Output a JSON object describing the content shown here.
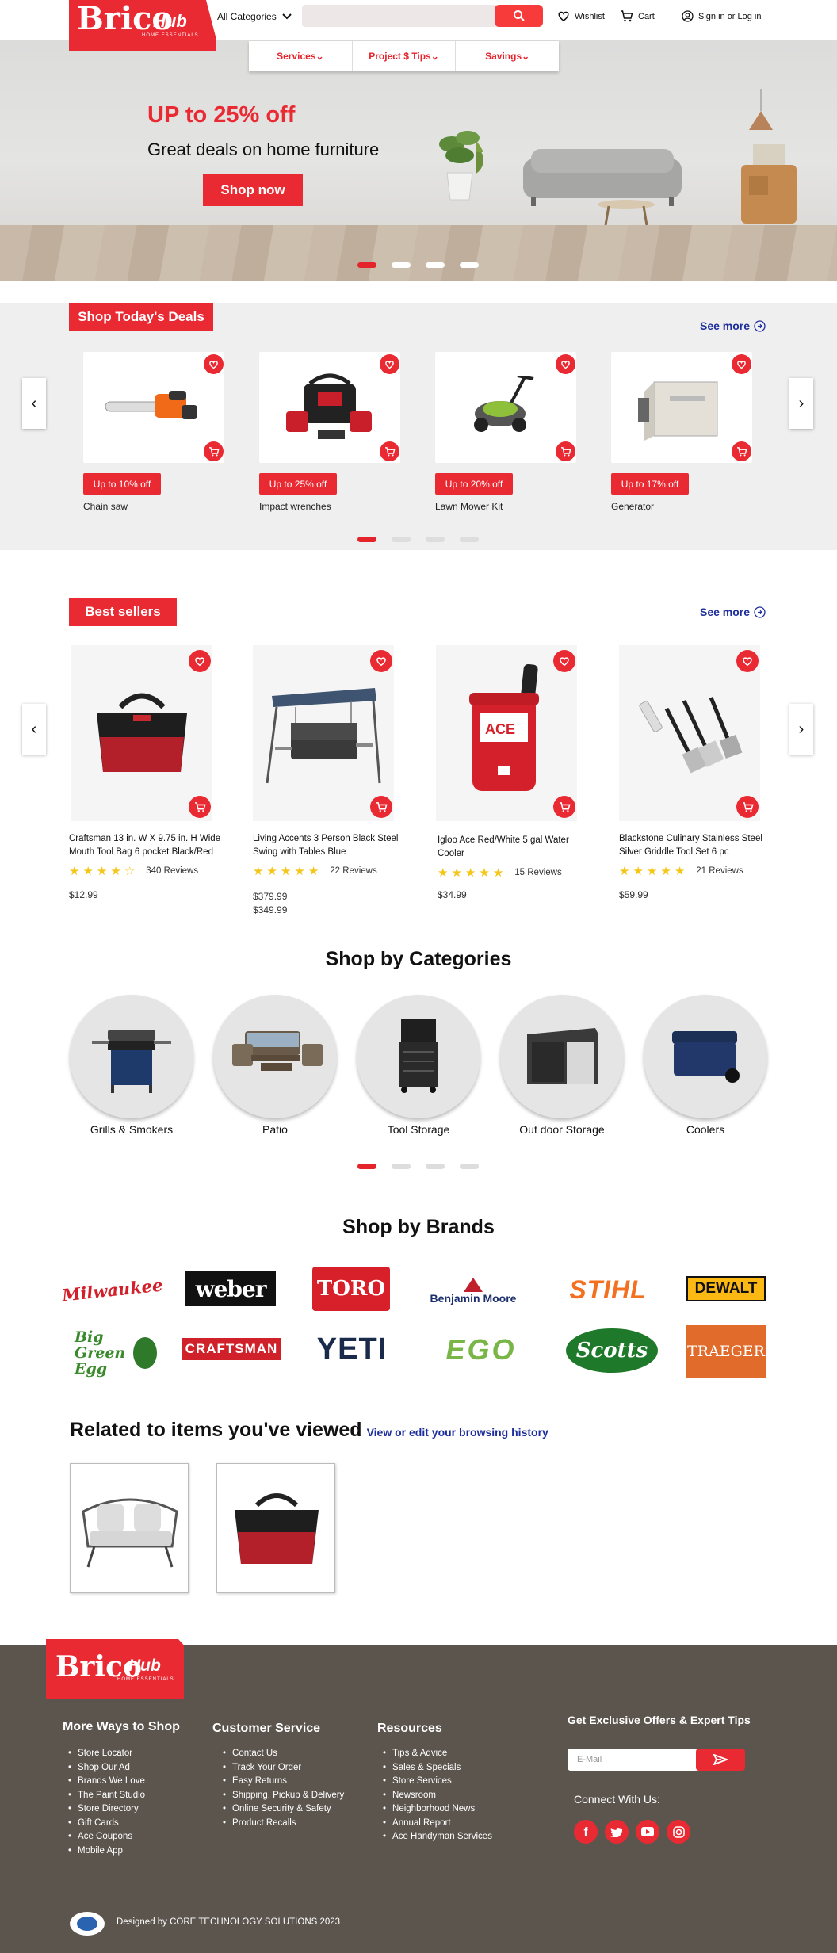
{
  "colors": {
    "brand_red": "#ea2a33",
    "link_blue": "#1d2e9c",
    "footer_bg": "#5c554e"
  },
  "header": {
    "logo_brico": "Brico",
    "logo_hub": "Hub",
    "logo_tagline": "HOME ESSENTIALS",
    "all_categories": "All Categories",
    "search_placeholder": "",
    "wishlist": "Wishlist",
    "cart": "Cart",
    "signin": "Sign in or Log in"
  },
  "nav": [
    {
      "label": "Services"
    },
    {
      "label": "Project $ Tips"
    },
    {
      "label": "Savings"
    }
  ],
  "hero": {
    "title": "UP to 25% off",
    "subtitle": "Great deals on home furniture",
    "button": "Shop now"
  },
  "deals": {
    "heading": "Shop Today's Deals",
    "see_more": "See more",
    "items": [
      {
        "badge": "Up to 10% off",
        "name": "Chain saw",
        "icon": "chainsaw-icon"
      },
      {
        "badge": "Up to 25% off",
        "name": "Impact wrenches",
        "icon": "drill-kit-icon"
      },
      {
        "badge": "Up to 20% off",
        "name": "Lawn Mower Kit",
        "icon": "lawn-mower-icon"
      },
      {
        "badge": "Up to 17% off",
        "name": "Generator",
        "icon": "generator-icon"
      }
    ]
  },
  "bestsellers": {
    "heading": "Best sellers",
    "see_more": "See more",
    "items": [
      {
        "name": "Craftsman 13 in. W X 9.75 in. H Wide Mouth Tool Bag 6 pocket Black/Red",
        "rating": 4,
        "reviews": "340 Reviews",
        "price": "$12.99",
        "price2": ""
      },
      {
        "name": "Living Accents 3 Person Black Steel Swing with Tables Blue",
        "rating": 5,
        "reviews": "22 Reviews",
        "price": "$379.99",
        "price2": "$349.99"
      },
      {
        "name": "Igloo Ace Red/White 5 gal Water Cooler",
        "rating": 5,
        "reviews": "15 Reviews",
        "price": "$34.99",
        "price2": ""
      },
      {
        "name": "Blackstone Culinary Stainless Steel Silver Griddle Tool Set 6 pc",
        "rating": 5,
        "reviews": "21 Reviews",
        "price": "$59.99",
        "price2": ""
      }
    ]
  },
  "categories": {
    "heading": "Shop by Categories",
    "items": [
      {
        "label": "Grills & Smokers"
      },
      {
        "label": "Patio"
      },
      {
        "label": "Tool Storage"
      },
      {
        "label": "Out door Storage"
      },
      {
        "label": "Coolers"
      }
    ]
  },
  "brands": {
    "heading": "Shop by Brands",
    "items": [
      "Milwaukee",
      "weber",
      "TORO",
      "Benjamin Moore",
      "STIHL",
      "DEWALT",
      "Big Green Egg",
      "CRAFTSMAN",
      "YETI",
      "EGO",
      "Scotts",
      "TRAEGER"
    ]
  },
  "related": {
    "heading": "Related to items you've viewed",
    "link": "View or edit your browsing history"
  },
  "footer": {
    "col1": {
      "heading": "More Ways to Shop",
      "items": [
        "Store Locator",
        "Shop Our Ad",
        "Brands We Love",
        "The Paint Studio",
        "Store Directory",
        "Gift Cards",
        "Ace Coupons",
        "Mobile App"
      ]
    },
    "col2": {
      "heading": "Customer Service",
      "items": [
        "Contact Us",
        "Track Your Order",
        "Easy Returns",
        "Shipping, Pickup & Delivery",
        "Online Security & Safety",
        "Product Recalls"
      ]
    },
    "col3": {
      "heading": "Resources",
      "items": [
        "Tips & Advice",
        "Sales & Specials",
        "Store Services",
        "Newsroom",
        "Neighborhood News",
        "Annual Report",
        "Ace Handyman Services"
      ]
    },
    "offers_heading": "Get Exclusive Offers & Expert Tips",
    "email_placeholder": "E-Mail",
    "connect": "Connect With Us:",
    "credit": "Designed by CORE TECHNOLOGY SOLUTIONS  2023"
  }
}
